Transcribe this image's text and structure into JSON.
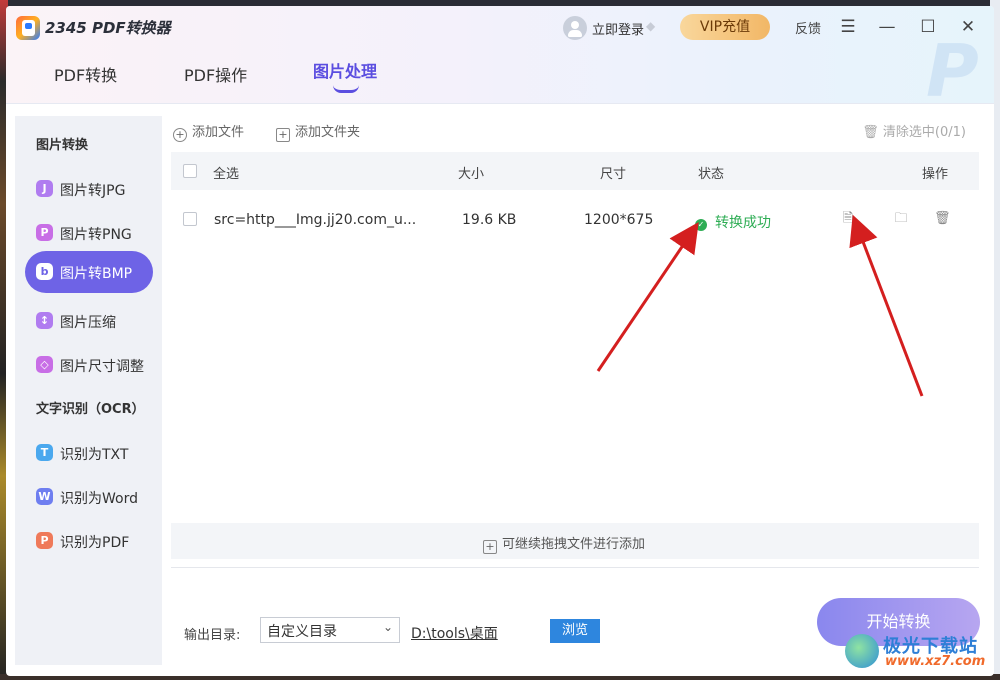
{
  "app": {
    "title": "2345 PDF转换器"
  },
  "header": {
    "login": "立即登录",
    "vip": "VIP充值",
    "feedback": "反馈",
    "menu_icon": "menu-icon",
    "minimize_icon": "minimize-icon",
    "maximize_icon": "maximize-icon",
    "close_icon": "close-icon"
  },
  "tabs": [
    {
      "label": "PDF转换",
      "active": false
    },
    {
      "label": "PDF操作",
      "active": false
    },
    {
      "label": "图片处理",
      "active": true
    }
  ],
  "sidebar": {
    "section1": "图片转换",
    "section2": "文字识别（OCR）",
    "items": [
      {
        "label": "图片转JPG",
        "icon": "J",
        "color": "#b07cf0",
        "active": false
      },
      {
        "label": "图片转PNG",
        "icon": "P",
        "color": "#c86ee6",
        "active": false
      },
      {
        "label": "图片转BMP",
        "icon": "b",
        "color": "#6e63e6",
        "active": true
      },
      {
        "label": "图片压缩",
        "icon": "↕",
        "color": "#b07cf0",
        "active": false
      },
      {
        "label": "图片尺寸调整",
        "icon": "◇",
        "color": "#c86ee6",
        "active": false
      },
      {
        "label": "识别为TXT",
        "icon": "T",
        "color": "#4aa8ee",
        "active": false
      },
      {
        "label": "识别为Word",
        "icon": "W",
        "color": "#6e7ef0",
        "active": false
      },
      {
        "label": "识别为PDF",
        "icon": "P",
        "color": "#ef7a5a",
        "active": false
      }
    ]
  },
  "toolbar": {
    "add_file": "添加文件",
    "add_folder": "添加文件夹",
    "clear_selected": "清除选中(0/1)"
  },
  "table": {
    "headers": {
      "select_all": "全选",
      "size": "大小",
      "dimension": "尺寸",
      "status": "状态",
      "actions": "操作"
    },
    "rows": [
      {
        "name": "src=http___Img.jj20.com_u...",
        "size": "19.6 KB",
        "dimension": "1200*675",
        "status": "转换成功"
      }
    ]
  },
  "drop_zone": {
    "text": "可继续拖拽文件进行添加"
  },
  "output": {
    "label": "输出目录:",
    "select_value": "自定义目录",
    "path": "D:\\tools\\桌面",
    "browse": "浏览"
  },
  "start_button": "开始转换",
  "watermark": {
    "text": "极光下载站",
    "sub": "www.xz7.com"
  },
  "colors": {
    "accent": "#6e63e6",
    "success": "#2fad55",
    "arrow": "#d41f1f",
    "browse": "#2e86de"
  }
}
